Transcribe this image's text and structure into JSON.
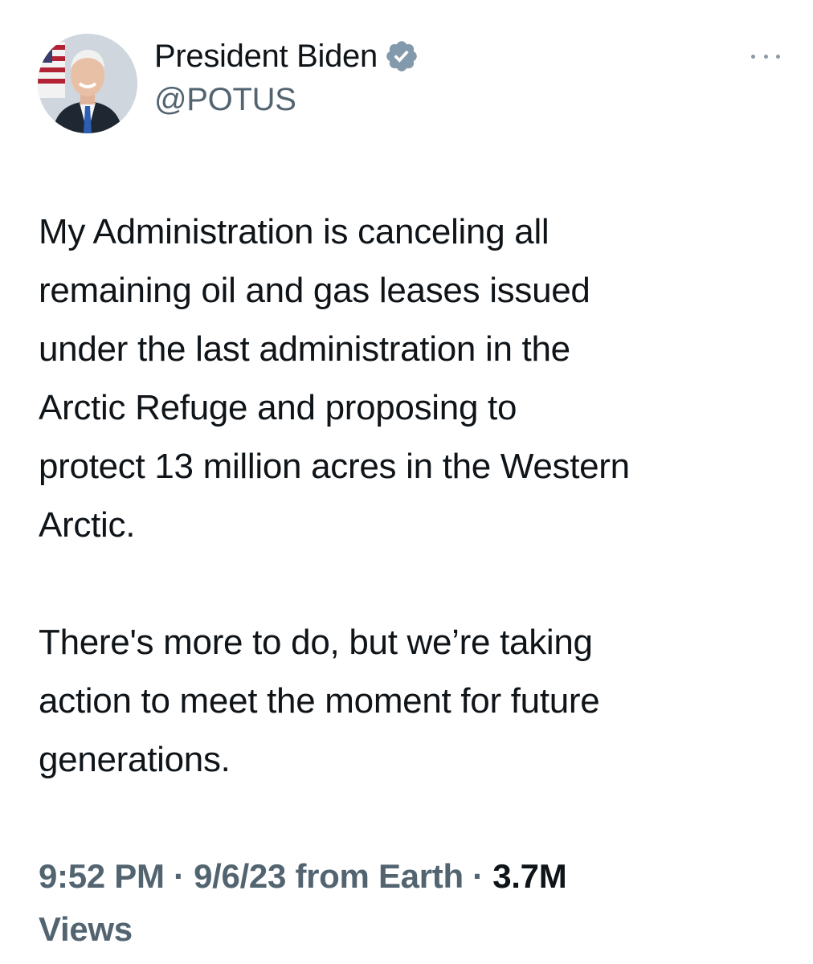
{
  "author": {
    "display_name": "President Biden",
    "handle": "@POTUS",
    "verified": true,
    "avatar_icon": "portrait-avatar"
  },
  "menu": {
    "icon": "more-horizontal-icon"
  },
  "tweet": {
    "paragraph_1": "My Administration is canceling all\nremaining oil and gas leases issued\nunder the last administration in the\nArctic Refuge and proposing to\nprotect 13 million acres in the Western\nArctic.",
    "paragraph_2": "There's more to do, but we’re taking\naction to meet the moment for future\ngenerations."
  },
  "meta": {
    "time": "9:52 PM",
    "separator": "·",
    "date": "9/6/23",
    "source": "from Earth",
    "views_count": "3.7M",
    "views_label": "Views"
  },
  "colors": {
    "text_primary": "#0f1419",
    "text_secondary": "#536471",
    "verified_badge": "#829aab"
  }
}
